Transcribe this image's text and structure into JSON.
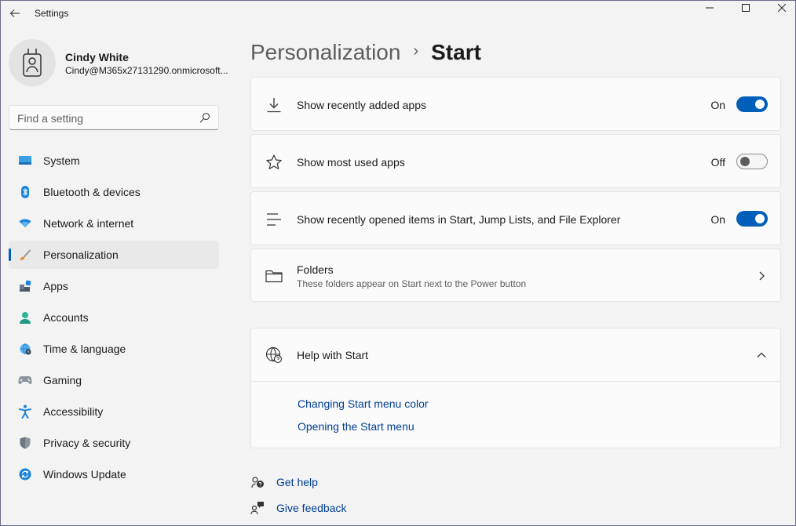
{
  "window": {
    "title": "Settings"
  },
  "profile": {
    "name": "Cindy White",
    "email": "Cindy@M365x27131290.onmicrosoft..."
  },
  "search": {
    "placeholder": "Find a setting",
    "value": ""
  },
  "sidebar": {
    "items": [
      {
        "label": "System",
        "icon": "system-icon"
      },
      {
        "label": "Bluetooth & devices",
        "icon": "bluetooth-icon"
      },
      {
        "label": "Network & internet",
        "icon": "wifi-icon"
      },
      {
        "label": "Personalization",
        "icon": "brush-icon",
        "selected": true
      },
      {
        "label": "Apps",
        "icon": "apps-icon"
      },
      {
        "label": "Accounts",
        "icon": "accounts-icon"
      },
      {
        "label": "Time & language",
        "icon": "globe-clock-icon"
      },
      {
        "label": "Gaming",
        "icon": "gamepad-icon"
      },
      {
        "label": "Accessibility",
        "icon": "accessibility-icon"
      },
      {
        "label": "Privacy & security",
        "icon": "shield-icon"
      },
      {
        "label": "Windows Update",
        "icon": "update-icon"
      }
    ]
  },
  "breadcrumb": {
    "parent": "Personalization",
    "separator": "›",
    "current": "Start"
  },
  "settings": {
    "recently_added": {
      "label": "Show recently added apps",
      "state": "On",
      "on": true
    },
    "most_used": {
      "label": "Show most used apps",
      "state": "Off",
      "on": false
    },
    "recently_opened": {
      "label": "Show recently opened items in Start, Jump Lists, and File Explorer",
      "state": "On",
      "on": true
    },
    "folders": {
      "label": "Folders",
      "description": "These folders appear on Start next to the Power button"
    }
  },
  "help": {
    "title": "Help with Start",
    "links": [
      "Changing Start menu color",
      "Opening the Start menu"
    ]
  },
  "footer": {
    "get_help": "Get help",
    "give_feedback": "Give feedback"
  },
  "colors": {
    "accent": "#005fb8",
    "link": "#003e92",
    "background": "#f3f3f3",
    "card": "#fbfbfb"
  }
}
